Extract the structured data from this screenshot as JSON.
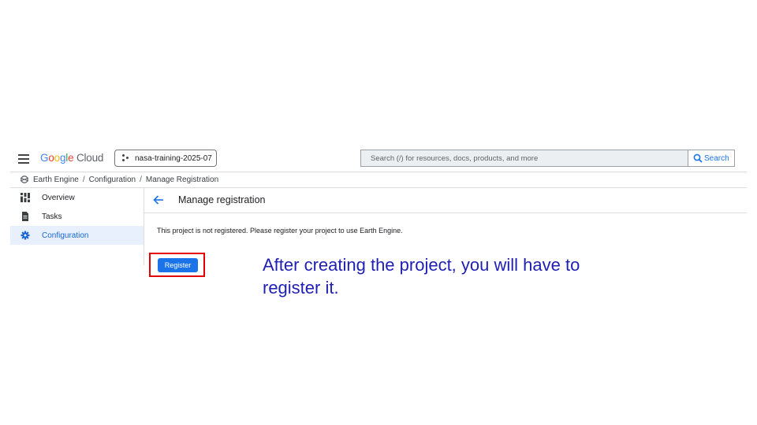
{
  "app": {
    "logo_letters": [
      "G",
      "o",
      "o",
      "g",
      "l",
      "e"
    ],
    "logo_suffix": "Cloud",
    "project": "nasa-training-2025-07",
    "search_placeholder": "Search (/) for resources, docs, products, and more",
    "search_button": "Search"
  },
  "breadcrumb": {
    "items": [
      "Earth Engine",
      "Configuration",
      "Manage Registration"
    ],
    "separator": "/"
  },
  "sidebar": {
    "items": [
      {
        "label": "Overview",
        "icon": "dashboard-icon",
        "active": false
      },
      {
        "label": "Tasks",
        "icon": "document-icon",
        "active": false
      },
      {
        "label": "Configuration",
        "icon": "gear-icon",
        "active": true
      }
    ]
  },
  "main": {
    "title": "Manage registration",
    "notice": "This project is not registered. Please register your project to use Earth Engine.",
    "register_button": "Register"
  },
  "annotation": {
    "text": "After creating the project, you will have to register it."
  },
  "colors": {
    "accent": "#1a73e8",
    "active_nav_bg": "#e8f0fe",
    "highlight": "#e10000",
    "annotation_text": "#1f1fb4"
  }
}
